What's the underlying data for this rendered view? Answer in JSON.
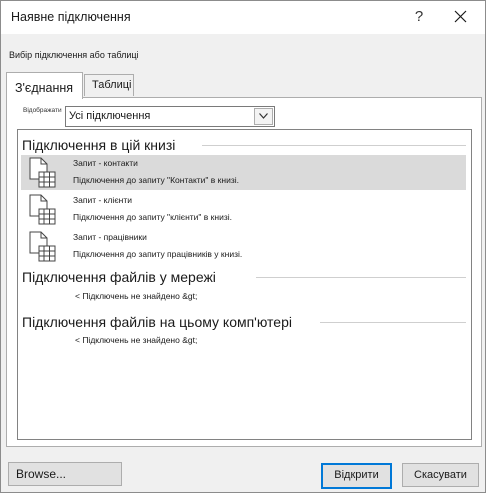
{
  "window": {
    "title": "Наявне підключення"
  },
  "titlebar": {
    "help_label": "?"
  },
  "section_label": "Вибір підключення або таблиці",
  "tabs": [
    {
      "label": "З'єднання",
      "active": true
    },
    {
      "label": "Таблиці",
      "active": false
    }
  ],
  "show_filter": {
    "label": "Відображати",
    "selected": "Усі підключення"
  },
  "groups": {
    "workbook": {
      "title": "Підключення в цій книзі",
      "items": [
        {
          "name": "Запит - контакти",
          "desc": "Підключення до запиту \"Контакти\" в книзі.",
          "icon": "table-file-icon",
          "selected": true
        },
        {
          "name": "Запит - клієнти",
          "desc": "Підключення до запиту \"клієнти\" в книзі.",
          "icon": "table-file-icon",
          "selected": false
        },
        {
          "name": "Запит - працівники",
          "desc": "Підключення до запиту працівників у книзі.",
          "icon": "table-file-icon",
          "selected": false
        }
      ]
    },
    "network": {
      "title": "Підключення файлів у мережі",
      "empty": "< Підключень не знайдено &gt;"
    },
    "computer": {
      "title": "Підключення файлів на цьому комп'ютері",
      "empty": "< Підключень не знайдено &gt;"
    }
  },
  "buttons": {
    "browse": "Browse...",
    "open": "Відкрити",
    "cancel": "Скасувати"
  },
  "colors": {
    "selected_row": "#dadada",
    "default_button_border": "#0078d7",
    "background": "#f0f0f0"
  }
}
